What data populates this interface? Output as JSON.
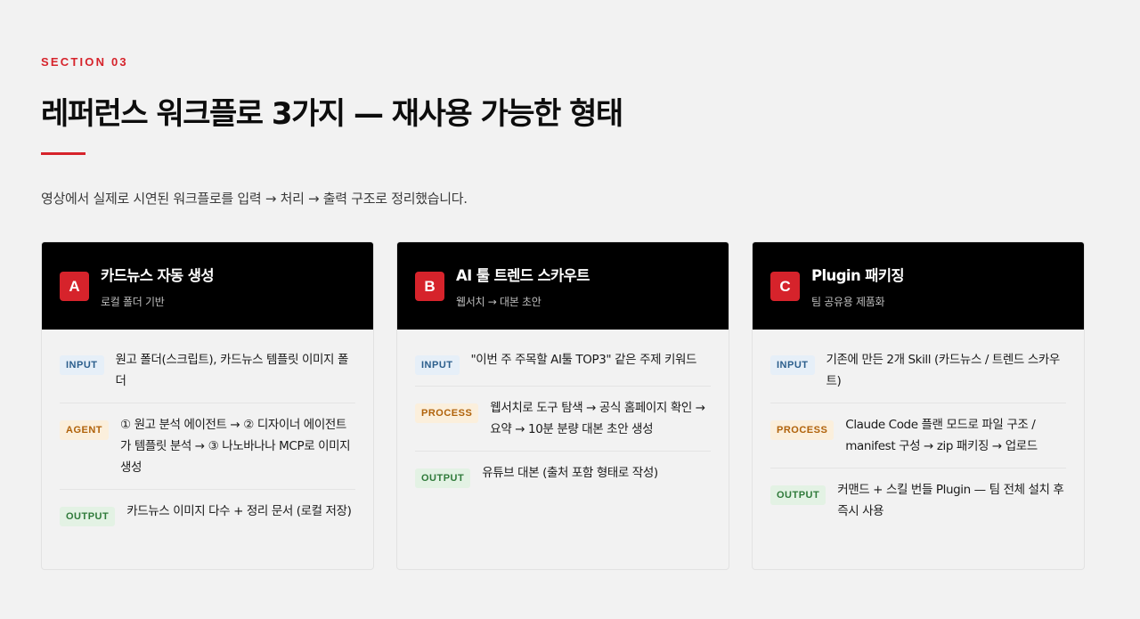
{
  "section_label": "SECTION 03",
  "title": "레퍼런스 워크플로 3가지 — 재사용 가능한 형태",
  "lead": "영상에서 실제로 시연된 워크플로를 입력 → 처리 → 출력 구조로 정리했습니다.",
  "accent_color": "#d6232b",
  "cards": [
    {
      "badge": "A",
      "title": "카드뉴스 자동 생성",
      "subtitle": "로컬 폴더 기반",
      "rows": [
        {
          "tag": "INPUT",
          "text": "원고 폴더(스크립트), 카드뉴스 템플릿 이미지 폴더"
        },
        {
          "tag": "AGENT",
          "text": "① 원고 분석 에이전트 → ② 디자이너 에이전트가 템플릿 분석 → ③ 나노바나나 MCP로 이미지 생성"
        },
        {
          "tag": "OUTPUT",
          "text": "카드뉴스 이미지 다수 + 정리 문서 (로컬 저장)"
        }
      ]
    },
    {
      "badge": "B",
      "title": "AI 툴 트렌드 스카우트",
      "subtitle": "웹서치 → 대본 초안",
      "rows": [
        {
          "tag": "INPUT",
          "text": "\"이번 주 주목할 AI툴 TOP3\" 같은 주제 키워드"
        },
        {
          "tag": "PROCESS",
          "text": "웹서치로 도구 탐색 → 공식 홈페이지 확인 → 요약 → 10분 분량 대본 초안 생성"
        },
        {
          "tag": "OUTPUT",
          "text": "유튜브 대본 (출처 포함 형태로 작성)"
        }
      ]
    },
    {
      "badge": "C",
      "title": "Plugin 패키징",
      "subtitle": "팀 공유용 제품화",
      "rows": [
        {
          "tag": "INPUT",
          "text": "기존에 만든 2개 Skill (카드뉴스 / 트렌드 스카우트)"
        },
        {
          "tag": "PROCESS",
          "text": "Claude Code 플랜 모드로 파일 구조 / manifest 구성 → zip 패키징 → 업로드"
        },
        {
          "tag": "OUTPUT",
          "text": "커맨드 + 스킬 번들 Plugin — 팀 전체 설치 후 즉시 사용"
        }
      ]
    }
  ]
}
